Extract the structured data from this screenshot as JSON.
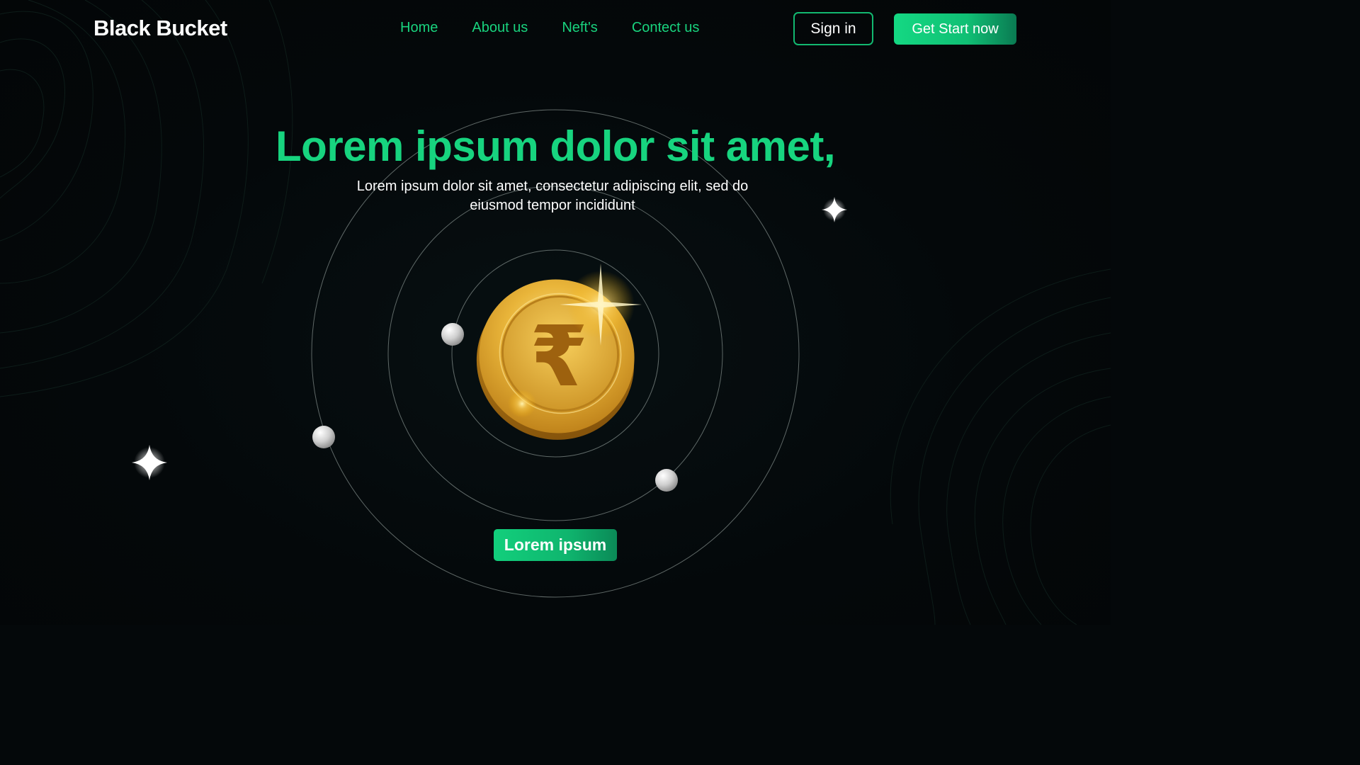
{
  "header": {
    "brand": "Black Bucket",
    "nav": [
      "Home",
      "About us",
      "Neft's",
      "Contect us"
    ],
    "signin_label": "Sign in",
    "get_start_label": "Get Start now"
  },
  "hero": {
    "title": "Lorem ipsum dolor sit amet,",
    "subtitle": "Lorem ipsum dolor sit amet, consectetur adipiscing elit, sed do eiusmod tempor incididunt",
    "cta_label": "Lorem ipsum",
    "coin_symbol": "₹"
  },
  "colors": {
    "accent": "#17d47f",
    "background": "#04080a",
    "coin_gold": "#e2a92a"
  },
  "icons": [
    "rupee-coin-icon",
    "sparkle-icon",
    "sphere-icon"
  ]
}
